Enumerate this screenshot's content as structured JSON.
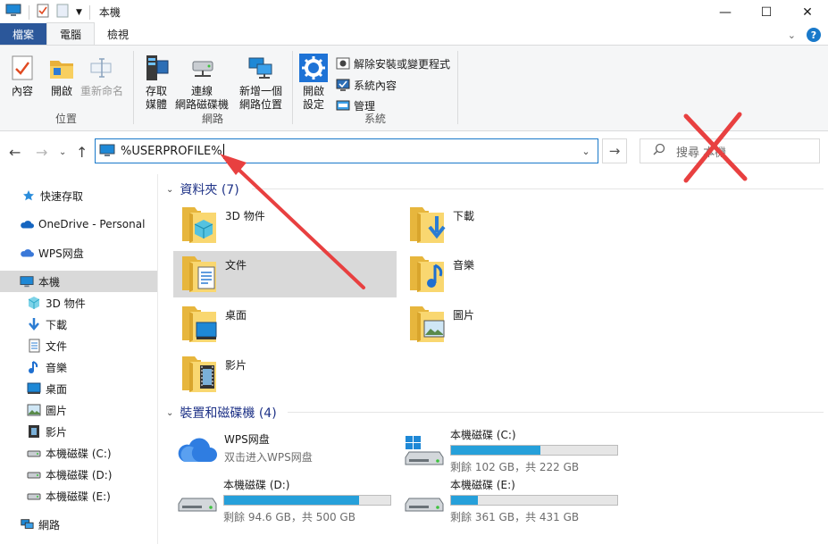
{
  "window": {
    "title": "本機",
    "tabs": [
      "檔案",
      "電腦",
      "檢視"
    ],
    "controls": {
      "minimize": "—",
      "maximize": "☐",
      "close": "✕"
    }
  },
  "ribbon": {
    "location": {
      "label": "位置",
      "buttons": [
        {
          "label": "內容",
          "icon": "properties-icon"
        },
        {
          "label": "開啟",
          "icon": "open-folder-icon"
        },
        {
          "label": "重新命名",
          "icon": "rename-icon",
          "disabled": true
        }
      ]
    },
    "network": {
      "label": "網路",
      "buttons": [
        {
          "label": "存取\n媒體",
          "icon": "media-access-icon"
        },
        {
          "label": "連線\n網路磁碟機",
          "icon": "network-drive-icon"
        },
        {
          "label": "新增一個\n網路位置",
          "icon": "network-location-icon"
        }
      ]
    },
    "system": {
      "label": "系統",
      "open_settings": "開啟\n設定",
      "items": [
        "解除安裝或變更程式",
        "系統內容",
        "管理"
      ]
    }
  },
  "address": {
    "value": "%USERPROFILE%",
    "search_placeholder": "搜尋 本機"
  },
  "sidebar": {
    "items": [
      {
        "label": "快速存取",
        "icon": "quick-access-star-icon"
      },
      {
        "label": "OneDrive - Personal",
        "icon": "onedrive-cloud-icon"
      },
      {
        "label": "WPS网盘",
        "icon": "wps-cloud-icon"
      },
      {
        "label": "本機",
        "icon": "this-pc-icon",
        "selected": true
      },
      {
        "label": "3D 物件",
        "icon": "3d-objects-icon"
      },
      {
        "label": "下載",
        "icon": "downloads-icon"
      },
      {
        "label": "文件",
        "icon": "documents-icon"
      },
      {
        "label": "音樂",
        "icon": "music-icon"
      },
      {
        "label": "桌面",
        "icon": "desktop-icon"
      },
      {
        "label": "圖片",
        "icon": "pictures-icon"
      },
      {
        "label": "影片",
        "icon": "videos-icon"
      },
      {
        "label": "本機磁碟 (C:)",
        "icon": "drive-icon"
      },
      {
        "label": "本機磁碟 (D:)",
        "icon": "drive-icon"
      },
      {
        "label": "本機磁碟 (E:)",
        "icon": "drive-icon"
      },
      {
        "label": "網路",
        "icon": "network-icon"
      }
    ]
  },
  "folders": {
    "header": "資料夾 (7)",
    "items": [
      {
        "label": "3D 物件",
        "icon": "3d-objects-folder-icon"
      },
      {
        "label": "下載",
        "icon": "downloads-folder-icon"
      },
      {
        "label": "文件",
        "icon": "documents-folder-icon",
        "selected": true
      },
      {
        "label": "音樂",
        "icon": "music-folder-icon"
      },
      {
        "label": "桌面",
        "icon": "desktop-folder-icon"
      },
      {
        "label": "圖片",
        "icon": "pictures-folder-icon"
      },
      {
        "label": "影片",
        "icon": "videos-folder-icon"
      }
    ]
  },
  "drives": {
    "header": "裝置和磁碟機 (4)",
    "items": [
      {
        "name": "WPS网盘",
        "subtitle": "双击进入WPS网盘",
        "icon": "wps-cloud-icon"
      },
      {
        "name": "本機磁碟 (C:)",
        "free": "剩餘 102 GB，共 222 GB",
        "used_fraction": 0.54,
        "icon": "windows-drive-icon"
      },
      {
        "name": "本機磁碟 (D:)",
        "free": "剩餘 94.6 GB，共 500 GB",
        "used_fraction": 0.81,
        "icon": "drive-icon"
      },
      {
        "name": "本機磁碟 (E:)",
        "free": "剩餘 361 GB，共 431 GB",
        "used_fraction": 0.16,
        "icon": "drive-icon"
      }
    ]
  },
  "annotations": {
    "arrow_color": "#e84040",
    "cross_color": "#e84040"
  }
}
